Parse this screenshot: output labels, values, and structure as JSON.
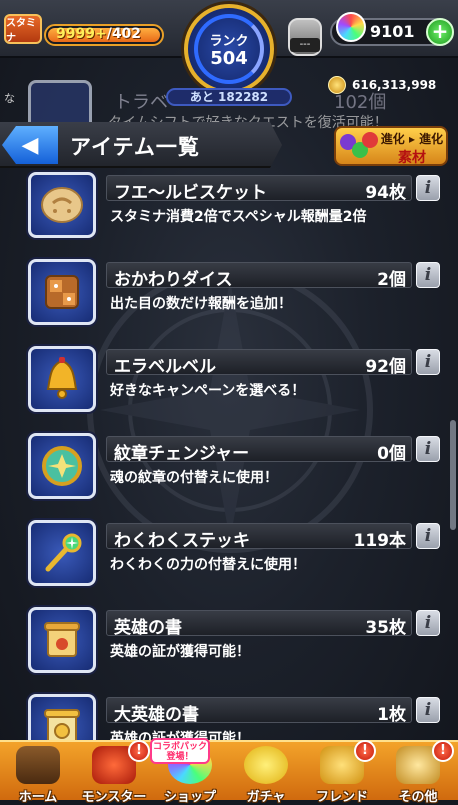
{
  "topbar": {
    "stamina_label": "スタミナ",
    "stamina_value": "9999+",
    "stamina_max": "/402",
    "rank_label": "ランク",
    "rank_value": "504",
    "next_rank": "あと 182282",
    "potion_count": "---",
    "gems": "9101",
    "add_symbol": "+",
    "coins": "616,313,998",
    "side_note": "な"
  },
  "ghost_item": {
    "name": "トラベ",
    "count": "102個",
    "desc": "タイムシフトで好きなクエストを復活可能！"
  },
  "header": {
    "back_symbol": "◀",
    "title": "アイテム一覧",
    "evo_line1": "進化 ▸ 進化",
    "evo_line2": "素材"
  },
  "items": [
    {
      "name": "フエ〜ルビスケット",
      "count": "94枚",
      "desc": "スタミナ消費2倍でスペシャル報酬量2倍",
      "icon": "biscuit-icon"
    },
    {
      "name": "おかわりダイス",
      "count": "2個",
      "desc": "出た目の数だけ報酬を追加！",
      "icon": "dice-icon"
    },
    {
      "name": "エラベルベル",
      "count": "92個",
      "desc": "好きなキャンペーンを選べる！",
      "icon": "bell-icon"
    },
    {
      "name": "紋章チェンジャー",
      "count": "0個",
      "desc": "魂の紋章の付替えに使用！",
      "icon": "emblem-icon"
    },
    {
      "name": "わくわくステッキ",
      "count": "119本",
      "desc": "わくわくの力の付替えに使用！",
      "icon": "wand-icon"
    },
    {
      "name": "英雄の書",
      "count": "35枚",
      "desc": "英雄の証が獲得可能！",
      "icon": "scroll-icon"
    },
    {
      "name": "大英雄の書",
      "count": "1枚",
      "desc": "英雄の証が獲得可能！",
      "icon": "great-scroll-icon"
    }
  ],
  "info_symbol": "i",
  "nav": {
    "tabs": [
      {
        "label": "ホーム"
      },
      {
        "label": "モンスター"
      },
      {
        "label": "ショップ"
      },
      {
        "label": "ガチャ"
      },
      {
        "label": "フレンド"
      },
      {
        "label": "その他"
      }
    ],
    "badge_symbol": "!",
    "collab_text": "コラボパック 登場！"
  },
  "colors": {
    "accent_orange": "#e9a028",
    "rank_blue": "#2f6bff",
    "nav_orange": "#f3a32a",
    "back_blue": "#1460d8"
  }
}
